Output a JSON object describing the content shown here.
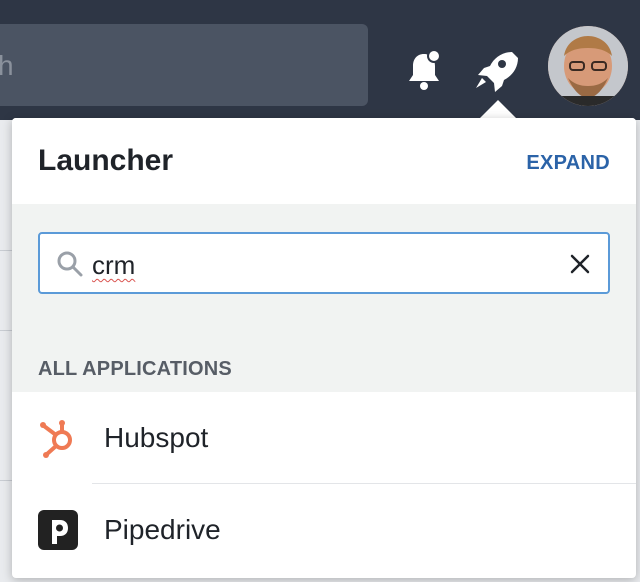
{
  "topbar": {
    "search_partial": "h",
    "icons": [
      "bell-icon",
      "rocket-icon",
      "avatar"
    ]
  },
  "launcher": {
    "title": "Launcher",
    "expand_label": "EXPAND",
    "search": {
      "value": "crm"
    },
    "section_label": "ALL APPLICATIONS",
    "apps": [
      {
        "label": "Hubspot",
        "icon": "hubspot-icon",
        "color": "#ef7a54"
      },
      {
        "label": "Pipedrive",
        "icon": "pipedrive-icon",
        "color": "#222222"
      }
    ]
  },
  "colors": {
    "topbar": "#2e3645",
    "accent": "#2b63a8",
    "focus_border": "#5b9ad8"
  }
}
